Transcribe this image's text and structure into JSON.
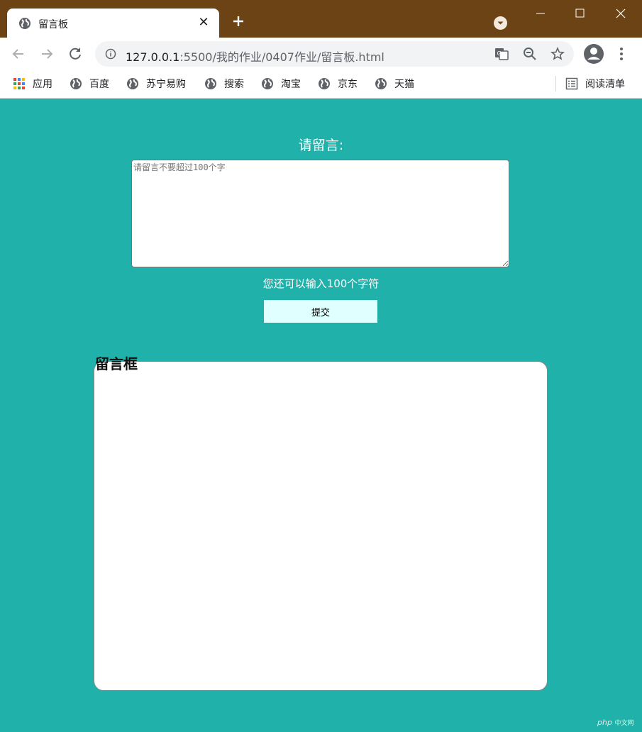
{
  "browser": {
    "tab_title": "留言板",
    "url_host": "127.0.0.1",
    "url_rest": ":5500/我的作业/0407作业/留言板.html",
    "bookmarks": [
      "应用",
      "百度",
      "苏宁易购",
      "搜索",
      "淘宝",
      "京东",
      "天猫"
    ],
    "reading_list": "阅读清单",
    "colors": {
      "titlebar": "#6b4314",
      "toolbar": "#ffffff"
    }
  },
  "page": {
    "heading": "请留言:",
    "textarea_placeholder": "请留言不要超过100个字",
    "counter_text": "您还可以输入100个字符",
    "submit_label": "提交",
    "board_title": "留言框",
    "background": "#20b2aa"
  },
  "watermark": {
    "brand": "php",
    "suffix": "中文网"
  }
}
